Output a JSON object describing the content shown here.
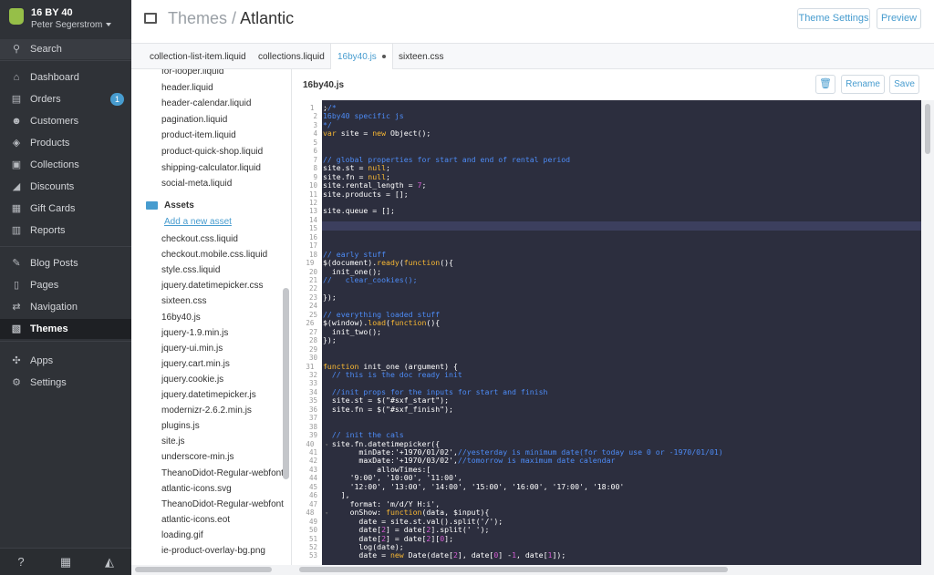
{
  "store": {
    "name": "16 BY 40",
    "user": "Peter Segerstrom"
  },
  "sidebar": {
    "search": "Search",
    "items": [
      {
        "label": "Dashboard",
        "icon": "home-icon",
        "glyph": "⌂"
      },
      {
        "label": "Orders",
        "icon": "inbox-icon",
        "glyph": "▤",
        "badge": "1"
      },
      {
        "label": "Customers",
        "icon": "customers-icon",
        "glyph": "☻"
      },
      {
        "label": "Products",
        "icon": "tag-icon",
        "glyph": "◈"
      },
      {
        "label": "Collections",
        "icon": "collections-icon",
        "glyph": "▣"
      },
      {
        "label": "Discounts",
        "icon": "discount-icon",
        "glyph": "◢"
      },
      {
        "label": "Gift Cards",
        "icon": "gift-icon",
        "glyph": "▦"
      },
      {
        "label": "Reports",
        "icon": "chart-icon",
        "glyph": "▥"
      },
      {
        "label": "Blog Posts",
        "icon": "blog-icon",
        "glyph": "✎"
      },
      {
        "label": "Pages",
        "icon": "pages-icon",
        "glyph": "▯"
      },
      {
        "label": "Navigation",
        "icon": "navigation-icon",
        "glyph": "⇄"
      },
      {
        "label": "Themes",
        "icon": "themes-icon",
        "glyph": "▧"
      },
      {
        "label": "Apps",
        "icon": "apps-icon",
        "glyph": "✣"
      },
      {
        "label": "Settings",
        "icon": "gear-icon",
        "glyph": "⚙"
      }
    ]
  },
  "header": {
    "section": "Themes",
    "separator": "/",
    "theme": "Atlantic",
    "theme_settings_label": "Theme Settings",
    "preview_label": "Preview"
  },
  "tabs": [
    "collection-list-item.liquid",
    "collections.liquid",
    "16by40.js",
    "sixteen.css"
  ],
  "files": {
    "snippets": [
      "for-looper.liquid",
      "header.liquid",
      "header-calendar.liquid",
      "pagination.liquid",
      "product-item.liquid",
      "product-quick-shop.liquid",
      "shipping-calculator.liquid",
      "social-meta.liquid"
    ],
    "assets_folder": "Assets",
    "add_asset": "Add a new asset",
    "assets": [
      {
        "name": "checkout.css.liquid",
        "type": "css"
      },
      {
        "name": "checkout.mobile.css.liquid",
        "type": "css"
      },
      {
        "name": "style.css.liquid",
        "type": "css"
      },
      {
        "name": "jquery.datetimepicker.css",
        "type": "css"
      },
      {
        "name": "sixteen.css",
        "type": "css"
      },
      {
        "name": "16by40.js",
        "type": "img"
      },
      {
        "name": "jquery-1.9.min.js",
        "type": "img"
      },
      {
        "name": "jquery-ui.min.js",
        "type": "img"
      },
      {
        "name": "jquery.cart.min.js",
        "type": "img"
      },
      {
        "name": "jquery.cookie.js",
        "type": "img"
      },
      {
        "name": "jquery.datetimepicker.js",
        "type": "img"
      },
      {
        "name": "modernizr-2.6.2.min.js",
        "type": "img"
      },
      {
        "name": "plugins.js",
        "type": "img"
      },
      {
        "name": "site.js",
        "type": "img"
      },
      {
        "name": "underscore-min.js",
        "type": "img"
      },
      {
        "name": "TheanoDidot-Regular-webfont.eot",
        "type": "doc"
      },
      {
        "name": "atlantic-icons.svg",
        "type": "doc"
      },
      {
        "name": "TheanoDidot-Regular-webfont.svg",
        "type": "doc"
      },
      {
        "name": "atlantic-icons.eot",
        "type": "doc"
      },
      {
        "name": "loading.gif",
        "type": "gif"
      },
      {
        "name": "ie-product-overlay-bg.png",
        "type": "gif"
      }
    ]
  },
  "editor": {
    "filename": "16by40.js",
    "rename_label": "Rename",
    "save_label": "Save",
    "delete_icon": "trash-icon",
    "lines": [
      [
        [
          "p",
          ";"
        ],
        [
          "c",
          "/*"
        ]
      ],
      [
        [
          "c",
          "16by40 specific js"
        ]
      ],
      [
        [
          "c",
          "*/"
        ]
      ],
      [
        [
          "k",
          "var "
        ],
        [
          "v",
          "site "
        ],
        [
          "p",
          "= "
        ],
        [
          "k",
          "new "
        ],
        [
          "v",
          "Object();"
        ]
      ],
      [],
      [],
      [
        [
          "c",
          "// global properties for start and end of rental period"
        ]
      ],
      [
        [
          "v",
          "site.st "
        ],
        [
          "p",
          "= "
        ],
        [
          "k",
          "null"
        ],
        [
          "p",
          ";"
        ]
      ],
      [
        [
          "v",
          "site.fn "
        ],
        [
          "p",
          "= "
        ],
        [
          "k",
          "null"
        ],
        [
          "p",
          ";"
        ]
      ],
      [
        [
          "v",
          "site.rental_length "
        ],
        [
          "p",
          "= "
        ],
        [
          "n",
          "7"
        ],
        [
          "p",
          ";"
        ]
      ],
      [
        [
          "v",
          "site.products "
        ],
        [
          "p",
          "= [];"
        ]
      ],
      [],
      [
        [
          "v",
          "site.queue "
        ],
        [
          "p",
          "= [];"
        ]
      ],
      [],
      [],
      [],
      [],
      [
        [
          "c",
          "// early stuff"
        ]
      ],
      [
        [
          "v",
          "$(document)."
        ],
        [
          "k",
          "ready"
        ],
        [
          "p",
          "("
        ],
        [
          "k",
          "function"
        ],
        [
          "p",
          "(){"
        ]
      ],
      [
        [
          "v",
          "  init_one();"
        ]
      ],
      [
        [
          "c",
          "//   clear_cookies();"
        ]
      ],
      [],
      [
        [
          "p",
          "});"
        ]
      ],
      [],
      [
        [
          "c",
          "// everything loaded stuff"
        ]
      ],
      [
        [
          "v",
          "$(window)."
        ],
        [
          "k",
          "load"
        ],
        [
          "p",
          "("
        ],
        [
          "k",
          "function"
        ],
        [
          "p",
          "(){"
        ]
      ],
      [
        [
          "v",
          "  init_two();"
        ]
      ],
      [
        [
          "p",
          "});"
        ]
      ],
      [],
      [],
      [
        [
          "k",
          "function "
        ],
        [
          "v",
          "init_one (argument) {"
        ]
      ],
      [
        [
          "c",
          "  // this is the doc ready init"
        ]
      ],
      [],
      [
        [
          "c",
          "  //init props for the inputs for start and finish"
        ]
      ],
      [
        [
          "v",
          "  site.st "
        ],
        [
          "p",
          "= "
        ],
        [
          "v",
          "$("
        ],
        [
          "s",
          "\"#sxf_start\""
        ],
        [
          "p",
          ");"
        ]
      ],
      [
        [
          "v",
          "  site.fn "
        ],
        [
          "p",
          "= "
        ],
        [
          "v",
          "$("
        ],
        [
          "s",
          "\"#sxf_finish\""
        ],
        [
          "p",
          ");"
        ]
      ],
      [],
      [],
      [
        [
          "c",
          "  // init the cals"
        ]
      ],
      [
        [
          "v",
          "  site.fn.datetimepicker({"
        ]
      ],
      [
        [
          "v",
          "        minDate:"
        ],
        [
          "s",
          "'+1970/01/02'"
        ],
        [
          "p",
          ","
        ],
        [
          "c",
          "//yesterday is minimum date(for today use 0 or -1970/01/01)"
        ]
      ],
      [
        [
          "v",
          "        maxDate:"
        ],
        [
          "s",
          "'+1970/03/02'"
        ],
        [
          "p",
          ","
        ],
        [
          "c",
          "//tomorrow is maximum date calendar"
        ]
      ],
      [
        [
          "v",
          "            allowTimes:["
        ]
      ],
      [
        [
          "s",
          "      '9:00'"
        ],
        [
          "p",
          ", "
        ],
        [
          "s",
          "'10:00'"
        ],
        [
          "p",
          ", "
        ],
        [
          "s",
          "'11:00'"
        ],
        [
          "p",
          ","
        ]
      ],
      [
        [
          "s",
          "      '12:00'"
        ],
        [
          "p",
          ", "
        ],
        [
          "s",
          "'13:00'"
        ],
        [
          "p",
          ", "
        ],
        [
          "s",
          "'14:00'"
        ],
        [
          "p",
          ", "
        ],
        [
          "s",
          "'15:00'"
        ],
        [
          "p",
          ", "
        ],
        [
          "s",
          "'16:00'"
        ],
        [
          "p",
          ", "
        ],
        [
          "s",
          "'17:00'"
        ],
        [
          "p",
          ", "
        ],
        [
          "s",
          "'18:00'"
        ]
      ],
      [
        [
          "p",
          "    ],"
        ]
      ],
      [
        [
          "v",
          "      format: "
        ],
        [
          "s",
          "'m/d/Y H:i'"
        ],
        [
          "p",
          ","
        ]
      ],
      [
        [
          "v",
          "      onShow: "
        ],
        [
          "k",
          "function"
        ],
        [
          "v",
          "(data, $input){"
        ]
      ],
      [
        [
          "v",
          "        date "
        ],
        [
          "p",
          "= "
        ],
        [
          "v",
          "site.st.val().split("
        ],
        [
          "s",
          "'/'"
        ],
        [
          "p",
          ");"
        ]
      ],
      [
        [
          "v",
          "        date["
        ],
        [
          "n",
          "2"
        ],
        [
          "v",
          "] "
        ],
        [
          "p",
          "= "
        ],
        [
          "v",
          "date["
        ],
        [
          "n",
          "2"
        ],
        [
          "v",
          "].split("
        ],
        [
          "s",
          "' '"
        ],
        [
          "p",
          ");"
        ]
      ],
      [
        [
          "v",
          "        date["
        ],
        [
          "n",
          "2"
        ],
        [
          "v",
          "] "
        ],
        [
          "p",
          "= "
        ],
        [
          "v",
          "date["
        ],
        [
          "n",
          "2"
        ],
        [
          "v",
          "]["
        ],
        [
          "n",
          "0"
        ],
        [
          "v",
          "];"
        ]
      ],
      [
        [
          "v",
          "        log(date);"
        ]
      ],
      [
        [
          "v",
          "        date "
        ],
        [
          "p",
          "= "
        ],
        [
          "k",
          "new "
        ],
        [
          "v",
          "Date(date["
        ],
        [
          "n",
          "2"
        ],
        [
          "v",
          "], date["
        ],
        [
          "n",
          "0"
        ],
        [
          "v",
          "] "
        ],
        [
          "p",
          "-"
        ],
        [
          "n",
          "1"
        ],
        [
          "v",
          ", date["
        ],
        [
          "n",
          "1"
        ],
        [
          "v",
          "]);"
        ]
      ]
    ],
    "fold_lines": [
      1,
      19,
      26,
      31,
      40,
      48
    ]
  }
}
